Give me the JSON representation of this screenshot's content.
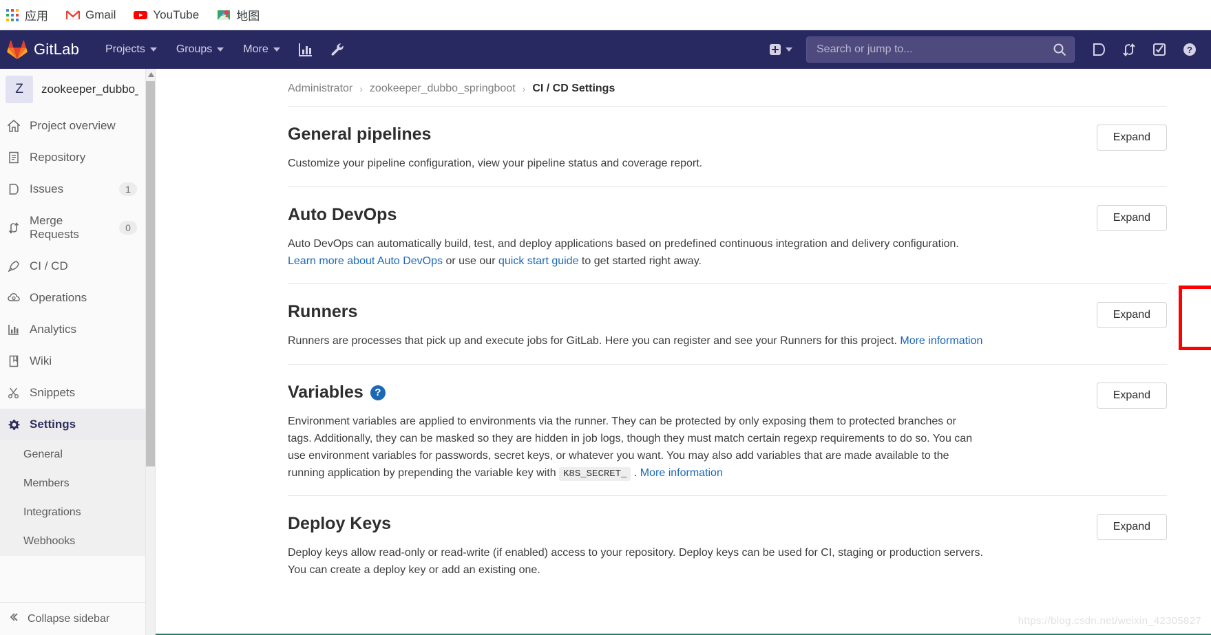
{
  "browser": {
    "bookmarks": [
      {
        "label": "应用",
        "icon": "apps-grid-icon"
      },
      {
        "label": "Gmail",
        "icon": "gmail-icon"
      },
      {
        "label": "YouTube",
        "icon": "youtube-icon"
      },
      {
        "label": "地图",
        "icon": "google-maps-icon"
      }
    ]
  },
  "navbar": {
    "brand": "GitLab",
    "brand_icon": "gitlab-logo-icon",
    "links": [
      {
        "label": "Projects",
        "icon": "chevron-down-icon"
      },
      {
        "label": "Groups",
        "icon": "chevron-down-icon"
      },
      {
        "label": "More",
        "icon": "chevron-down-icon"
      }
    ],
    "icon_buttons": [
      {
        "name": "analytics-icon"
      },
      {
        "name": "admin-wrench-icon"
      }
    ],
    "create_new_label": "",
    "search": {
      "placeholder": "Search or jump to...",
      "value": ""
    },
    "right_icons": [
      {
        "name": "issues-icon"
      },
      {
        "name": "merge-requests-icon"
      },
      {
        "name": "todos-icon"
      },
      {
        "name": "help-icon"
      }
    ],
    "colors": {
      "background": "#292961",
      "search_background": "#4e4a7d",
      "link_text": "#d6d2e6"
    }
  },
  "sidebar": {
    "project": {
      "avatar_letter": "Z",
      "name": "zookeeper_dubbo_sp..."
    },
    "items": [
      {
        "label": "Project overview",
        "icon": "home-icon",
        "badge": null,
        "active": false
      },
      {
        "label": "Repository",
        "icon": "document-icon",
        "badge": null,
        "active": false
      },
      {
        "label": "Issues",
        "icon": "issues-icon",
        "badge": "1",
        "active": false
      },
      {
        "label": "Merge Requests",
        "icon": "merge-requests-icon",
        "badge": "0",
        "active": false
      },
      {
        "label": "CI / CD",
        "icon": "rocket-icon",
        "badge": null,
        "active": false
      },
      {
        "label": "Operations",
        "icon": "cloud-gear-icon",
        "badge": null,
        "active": false
      },
      {
        "label": "Analytics",
        "icon": "chart-icon",
        "badge": null,
        "active": false
      },
      {
        "label": "Wiki",
        "icon": "book-icon",
        "badge": null,
        "active": false
      },
      {
        "label": "Snippets",
        "icon": "scissors-icon",
        "badge": null,
        "active": false
      },
      {
        "label": "Settings",
        "icon": "gear-icon",
        "badge": null,
        "active": true
      }
    ],
    "settings_subitems": [
      {
        "label": "General"
      },
      {
        "label": "Members"
      },
      {
        "label": "Integrations"
      },
      {
        "label": "Webhooks"
      }
    ],
    "collapse_label": "Collapse sidebar",
    "collapse_icon": "collapse-icon"
  },
  "breadcrumb": {
    "items": [
      {
        "label": "Administrator",
        "current": false
      },
      {
        "label": "zookeeper_dubbo_springboot",
        "current": false
      },
      {
        "label": "CI / CD Settings",
        "current": true
      }
    ],
    "separator": "›"
  },
  "sections": [
    {
      "id": "general-pipelines",
      "title": "General pipelines",
      "has_help": false,
      "expand_label": "Expand",
      "desc_parts": [
        {
          "type": "text",
          "text": "Customize your pipeline configuration, view your pipeline status and coverage report."
        }
      ],
      "highlighted": false
    },
    {
      "id": "auto-devops",
      "title": "Auto DevOps",
      "has_help": false,
      "expand_label": "Expand",
      "desc_parts": [
        {
          "type": "text",
          "text": "Auto DevOps can automatically build, test, and deploy applications based on predefined continuous integration and delivery configuration. "
        },
        {
          "type": "link",
          "text": "Learn more about Auto DevOps"
        },
        {
          "type": "text",
          "text": " or use our "
        },
        {
          "type": "link",
          "text": "quick start guide"
        },
        {
          "type": "text",
          "text": " to get started right away."
        }
      ],
      "highlighted": false
    },
    {
      "id": "runners",
      "title": "Runners",
      "has_help": false,
      "expand_label": "Expand",
      "desc_parts": [
        {
          "type": "text",
          "text": "Runners are processes that pick up and execute jobs for GitLab. Here you can register and see your Runners for this project. "
        },
        {
          "type": "link",
          "text": "More information"
        }
      ],
      "highlighted": true
    },
    {
      "id": "variables",
      "title": "Variables",
      "has_help": true,
      "help_glyph": "?",
      "expand_label": "Expand",
      "desc_parts": [
        {
          "type": "text",
          "text": "Environment variables are applied to environments via the runner. They can be protected by only exposing them to protected branches or tags. Additionally, they can be masked so they are hidden in job logs, though they must match certain regexp requirements to do so. You can use environment variables for passwords, secret keys, or whatever you want. You may also add variables that are made available to the running application by prepending the variable key with "
        },
        {
          "type": "code",
          "text": "K8S_SECRET_"
        },
        {
          "type": "text",
          "text": " . "
        },
        {
          "type": "link",
          "text": "More information"
        }
      ],
      "highlighted": false
    },
    {
      "id": "deploy-keys",
      "title": "Deploy Keys",
      "has_help": false,
      "expand_label": "Expand",
      "desc_parts": [
        {
          "type": "text",
          "text": "Deploy keys allow read-only or read-write (if enabled) access to your repository. Deploy keys can be used for CI, staging or production servers. You can create a deploy key or add an existing one."
        }
      ],
      "highlighted": false
    }
  ],
  "annotation": {
    "color": "#ff0000",
    "target": "runners-expand-button"
  },
  "watermark": {
    "text": "https://blog.csdn.net/weixin_42305827"
  }
}
